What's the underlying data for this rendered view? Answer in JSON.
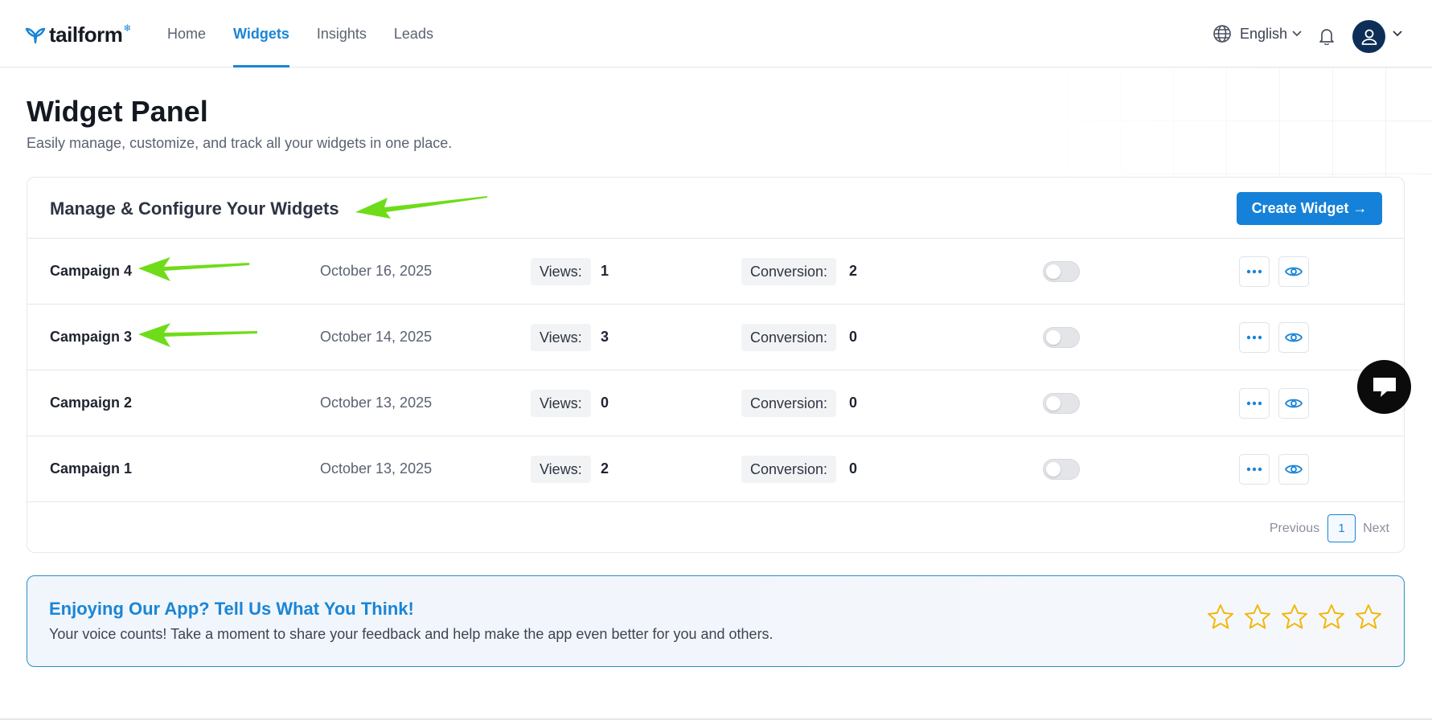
{
  "header": {
    "logo_text": "tailform",
    "nav": [
      {
        "label": "Home",
        "active": false
      },
      {
        "label": "Widgets",
        "active": true
      },
      {
        "label": "Insights",
        "active": false
      },
      {
        "label": "Leads",
        "active": false
      }
    ],
    "language": "English",
    "icons": {
      "language": "globe-icon",
      "notifications": "bell-icon",
      "account": "user-icon"
    }
  },
  "page": {
    "title": "Widget Panel",
    "subtitle": "Easily manage, customize, and track all your widgets in one place."
  },
  "widgets_card": {
    "title": "Manage & Configure Your Widgets",
    "create_button": "Create Widget →",
    "views_label": "Views:",
    "conversion_label": "Conversion:",
    "rows": [
      {
        "name": "Campaign 4",
        "date": "October 16, 2025",
        "views": "1",
        "conversion": "2",
        "enabled": false
      },
      {
        "name": "Campaign 3",
        "date": "October 14, 2025",
        "views": "3",
        "conversion": "0",
        "enabled": false
      },
      {
        "name": "Campaign 2",
        "date": "October 13, 2025",
        "views": "0",
        "conversion": "0",
        "enabled": false
      },
      {
        "name": "Campaign 1",
        "date": "October 13, 2025",
        "views": "2",
        "conversion": "0",
        "enabled": false
      }
    ],
    "pagination": {
      "previous": "Previous",
      "current": "1",
      "next": "Next"
    }
  },
  "feedback": {
    "title": "Enjoying Our App? Tell Us What You Think!",
    "text": "Your voice counts! Take a moment to share your feedback and help make the app even better for you and others.",
    "stars": 5,
    "rating": 0
  },
  "colors": {
    "accent": "#1a85d6",
    "button": "#1581d8",
    "avatar": "#0d2f57",
    "star": "#f2b705",
    "annotation_arrow": "#6fdc1a",
    "chat_bubble": "#0b0b0c"
  }
}
